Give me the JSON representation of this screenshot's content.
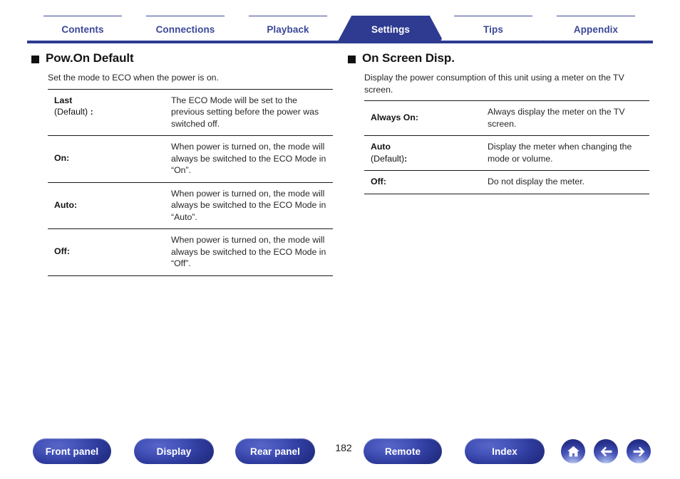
{
  "tabs": [
    {
      "label": "Contents",
      "active": false
    },
    {
      "label": "Connections",
      "active": false
    },
    {
      "label": "Playback",
      "active": false
    },
    {
      "label": "Settings",
      "active": true
    },
    {
      "label": "Tips",
      "active": false
    },
    {
      "label": "Appendix",
      "active": false
    }
  ],
  "sections": [
    {
      "heading": "Pow.On Default",
      "intro": "Set the mode to ECO when the power is on.",
      "rows": [
        {
          "term": "Last",
          "sub": "(Default)",
          "sub_colon": " :",
          "desc": "The ECO Mode will be set to the previous setting before the power was switched off."
        },
        {
          "term": "On:",
          "desc": "When power is turned on, the mode will always be switched to the ECO Mode in “On”."
        },
        {
          "term": "Auto:",
          "desc": "When power is turned on, the mode will always be switched to the ECO Mode in “Auto”."
        },
        {
          "term": "Off:",
          "desc": "When power is turned on, the mode will always be switched to the ECO Mode in “Off”."
        }
      ]
    },
    {
      "heading": "On Screen Disp.",
      "intro": "Display the power consumption of this unit using a meter on the TV screen.",
      "rows": [
        {
          "term": "Always On:",
          "desc": "Always display the meter on the TV screen."
        },
        {
          "term": "Auto",
          "sub": "(Default)",
          "sub_colon": ":",
          "desc": "Display the meter when changing the mode or volume."
        },
        {
          "term": "Off:",
          "desc": "Do not display the meter."
        }
      ]
    }
  ],
  "footer": {
    "buttons": [
      {
        "label": "Front panel"
      },
      {
        "label": "Display"
      },
      {
        "label": "Rear panel"
      },
      {
        "label": "Remote"
      },
      {
        "label": "Index"
      }
    ],
    "page_number": "182",
    "icons": [
      {
        "name": "home-icon"
      },
      {
        "name": "arrow-left-icon"
      },
      {
        "name": "arrow-right-icon"
      }
    ]
  },
  "colors": {
    "brand_blue": "#2e3b91",
    "tab_outline": "#3b4799",
    "text": "#262626"
  }
}
